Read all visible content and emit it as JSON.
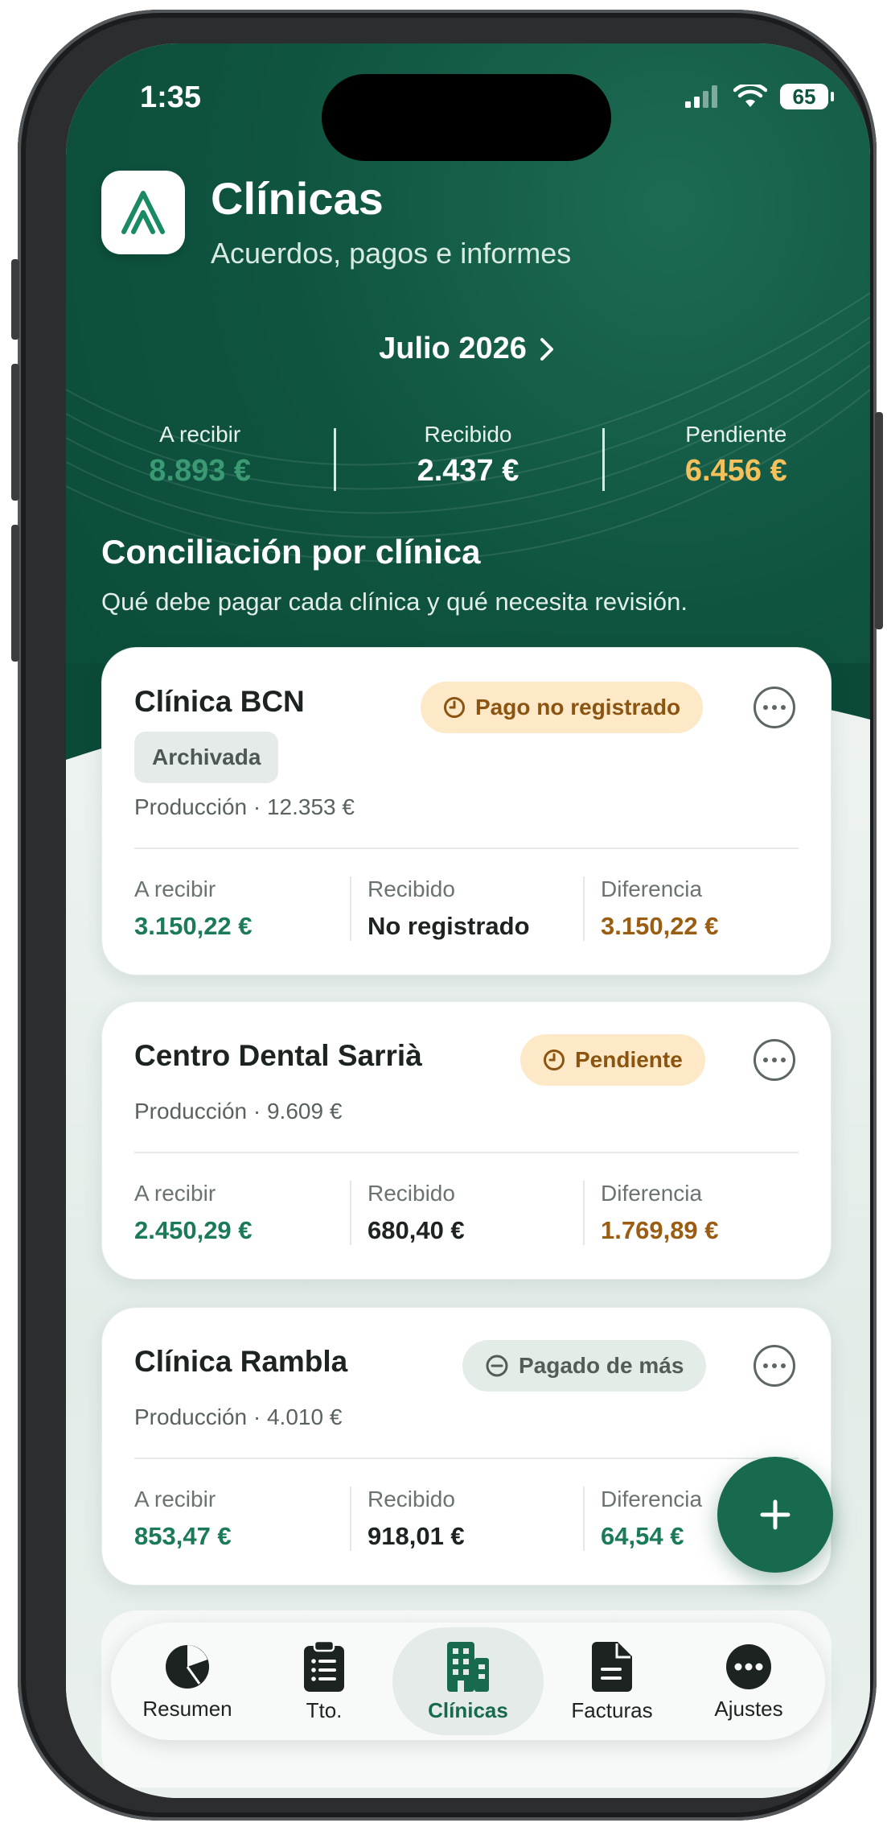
{
  "status_bar": {
    "time": "1:35",
    "battery": "65"
  },
  "header": {
    "title": "Clínicas",
    "subtitle": "Acuerdos, pagos e informes"
  },
  "month_selector": {
    "label": "Julio 2026"
  },
  "summary": [
    {
      "label": "A recibir",
      "value": "8.893 €",
      "color": "#3a9a74"
    },
    {
      "label": "Recibido",
      "value": "2.437 €",
      "color": "#ffffff"
    },
    {
      "label": "Pendiente",
      "value": "6.456 €",
      "color": "#f5c15c"
    }
  ],
  "section": {
    "title": "Conciliación por clínica",
    "subtitle": "Qué debe pagar cada clínica y qué necesita revisión."
  },
  "clinics": [
    {
      "name": "Clínica BCN",
      "status": "Pago no registrado",
      "status_icon": "clock-icon",
      "archived_chip": "Archivada",
      "production": "Producción · 12.353 €",
      "stats": [
        {
          "label": "A recibir",
          "value": "3.150,22 €",
          "color": "#1b7a57"
        },
        {
          "label": "Recibido",
          "value": "No registrado",
          "color": "#1d2320"
        },
        {
          "label": "Diferencia",
          "value": "3.150,22 €",
          "color": "#9a5d12"
        }
      ]
    },
    {
      "name": "Centro Dental Sarrià",
      "status": "Pendiente",
      "status_icon": "clock-icon",
      "production": "Producción · 9.609 €",
      "stats": [
        {
          "label": "A recibir",
          "value": "2.450,29 €",
          "color": "#1b7a57"
        },
        {
          "label": "Recibido",
          "value": "680,40 €",
          "color": "#1d2320"
        },
        {
          "label": "Diferencia",
          "value": "1.769,89 €",
          "color": "#9a5d12"
        }
      ]
    },
    {
      "name": "Clínica Rambla",
      "status": "Pagado de más",
      "status_icon": "minus-circle-icon",
      "production": "Producción · 4.010 €",
      "stats": [
        {
          "label": "A recibir",
          "value": "853,47 €",
          "color": "#1b7a57"
        },
        {
          "label": "Recibido",
          "value": "918,01 €",
          "color": "#1d2320"
        },
        {
          "label": "Diferencia",
          "value": "64,54 €",
          "color": "#1b7a57"
        }
      ]
    }
  ],
  "tabbar": [
    {
      "label": "Resumen",
      "icon": "pie-chart-icon",
      "active": false
    },
    {
      "label": "Tto.",
      "icon": "clipboard-list-icon",
      "active": false
    },
    {
      "label": "Clínicas",
      "icon": "building-icon",
      "active": true
    },
    {
      "label": "Facturas",
      "icon": "document-icon",
      "active": false
    },
    {
      "label": "Ajustes",
      "icon": "more-icon",
      "active": false
    }
  ],
  "colors": {
    "brand": "#0f5440",
    "accent": "#176a4e",
    "warning_bg": "#fde9c8",
    "warning_text": "#8b5410"
  }
}
